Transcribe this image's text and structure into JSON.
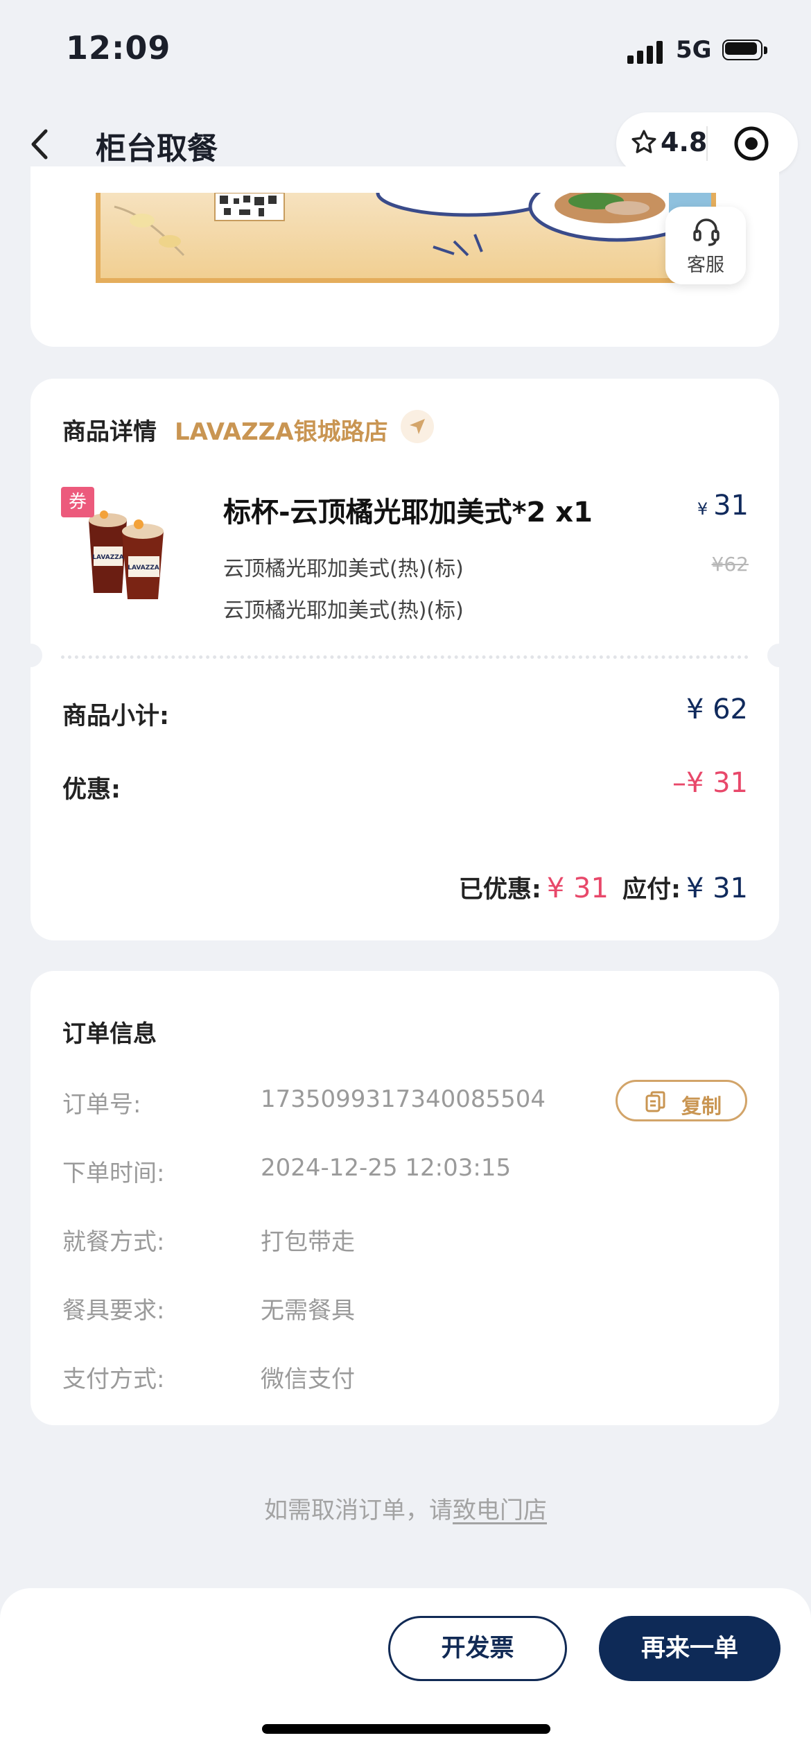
{
  "status_bar": {
    "time": "12:09",
    "network": "5G"
  },
  "nav": {
    "title": "柜台取餐",
    "rating": "4.8"
  },
  "service": {
    "label": "客服"
  },
  "product_section": {
    "title": "商品详情",
    "store": "LAVAZZA银城路店",
    "coupon_tag": "券",
    "item": {
      "name": "标杯-云顶橘光耶加美式*2 x1",
      "price_currency": "¥",
      "price": "31",
      "original_price": "¥62",
      "options": [
        "云顶橘光耶加美式(热)(标)",
        "云顶橘光耶加美式(热)(标)"
      ]
    },
    "subtotal_label": "商品小计:",
    "subtotal_value": "¥ 62",
    "discount_label": "优惠:",
    "discount_value": "–¥ 31",
    "saved_label": "已优惠:",
    "saved_value": "¥ 31",
    "payable_label": "应付:",
    "payable_value": "¥ 31"
  },
  "order_info": {
    "title": "订单信息",
    "copy_label": "复制",
    "rows": [
      {
        "label": "订单号:",
        "value": "1735099317340085504"
      },
      {
        "label": "下单时间:",
        "value": "2024-12-25 12:03:15"
      },
      {
        "label": "就餐方式:",
        "value": "打包带走"
      },
      {
        "label": "餐具要求:",
        "value": "无需餐具"
      },
      {
        "label": "支付方式:",
        "value": "微信支付"
      }
    ]
  },
  "cancel_note": {
    "prefix": "如需取消订单，请",
    "link": "致电门店"
  },
  "actions": {
    "invoice": "开发票",
    "reorder": "再来一单"
  },
  "colors": {
    "accent_gold": "#c99552",
    "navy": "#0e2a57",
    "discount_red": "#e8486a"
  }
}
